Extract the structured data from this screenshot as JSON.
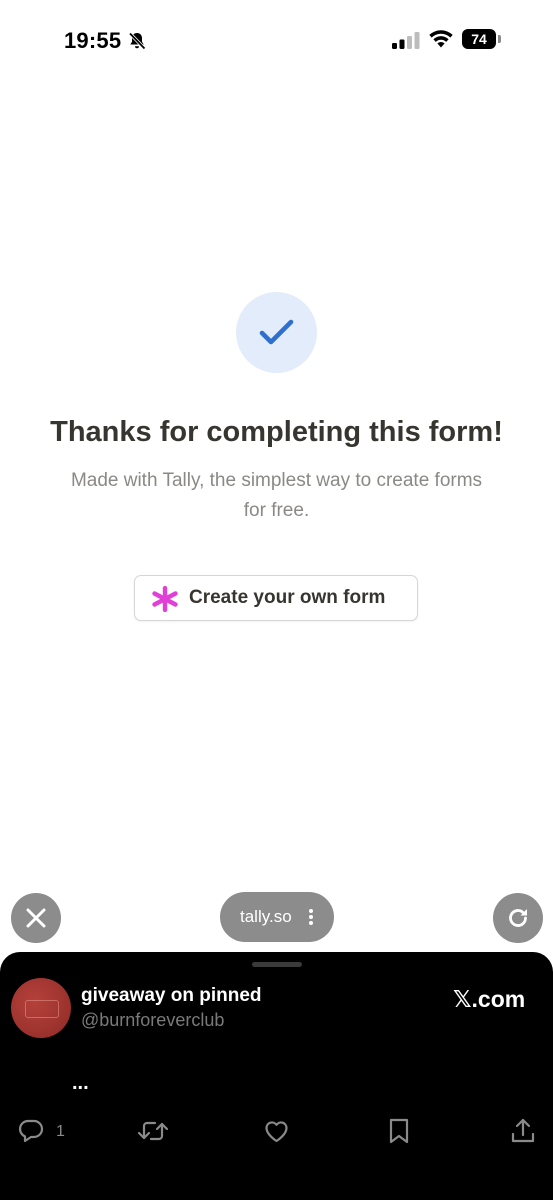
{
  "status_bar": {
    "time": "19:55",
    "battery": "74",
    "icons": [
      "bell-slash-icon",
      "signal-icon",
      "wifi-icon",
      "battery-icon"
    ]
  },
  "form_result": {
    "heading": "Thanks for completing this form!",
    "subtext": "Made with Tally, the simplest way to create forms for free.",
    "cta_label": "Create your own form",
    "accent": "#2f6fce",
    "cta_star_color": "#e040d6"
  },
  "browser_controls": {
    "url": "tally.so",
    "icons": [
      "close-icon",
      "more-vertical-icon",
      "reload-icon"
    ]
  },
  "tweet_card": {
    "title": "giveaway on pinned",
    "handle": "@burnforeverclub",
    "source": "𝕏.com",
    "body": "...",
    "reply_count": "1",
    "icons": [
      "reply-icon",
      "retweet-icon",
      "like-icon",
      "bookmark-icon",
      "share-icon"
    ]
  }
}
